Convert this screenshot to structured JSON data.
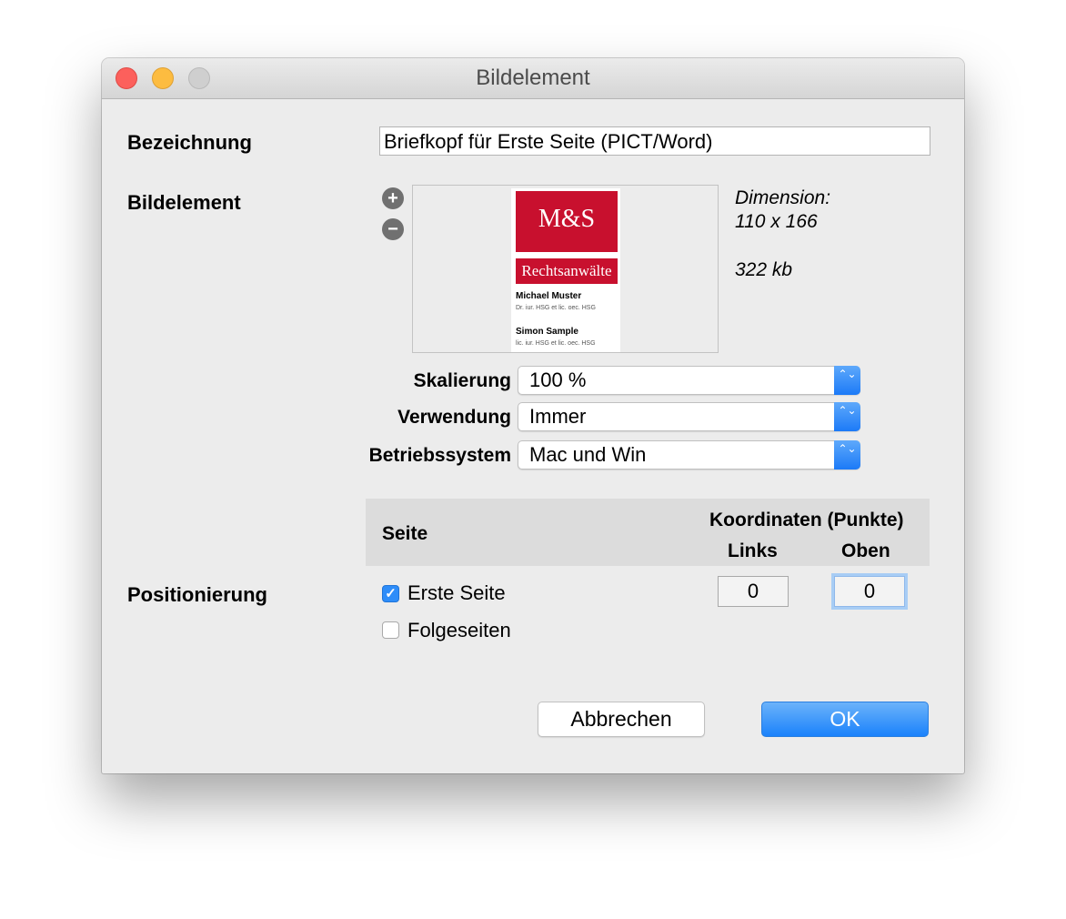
{
  "window": {
    "title": "Bildelement"
  },
  "bezeichnung": {
    "label": "Bezeichnung",
    "value": "Briefkopf für Erste Seite (PICT/Word)"
  },
  "bildelement": {
    "label": "Bildelement",
    "zoom_in": "+",
    "zoom_out": "−",
    "preview": {
      "logo_text": "M&S",
      "logo_subtitle": "Rechtsanwälte",
      "person1_name": "Michael Muster",
      "person1_title": "Dr. iur. HSG et lic. oec. HSG",
      "person2_name": "Simon Sample",
      "person2_title": "lic. iur. HSG et lic. oec. HSG"
    },
    "dimension_label": "Dimension:",
    "dimension_value": "110 x 166",
    "size": "322 kb"
  },
  "skalierung": {
    "label": "Skalierung",
    "value": "100 %"
  },
  "verwendung": {
    "label": "Verwendung",
    "value": "Immer"
  },
  "betriebssystem": {
    "label": "Betriebssystem",
    "value": "Mac und Win"
  },
  "popup_arrows": "⌃⌄",
  "positionierung": {
    "label": "Positionierung",
    "header_seite": "Seite",
    "header_koordinaten": "Koordinaten (Punkte)",
    "header_links": "Links",
    "header_oben": "Oben",
    "check_symbol": "✓",
    "rows": [
      {
        "label": "Erste Seite",
        "checked": true,
        "links": "0",
        "oben": "0"
      },
      {
        "label": "Folgeseiten",
        "checked": false
      }
    ]
  },
  "buttons": {
    "cancel": "Abbrechen",
    "ok": "OK"
  },
  "colors": {
    "accent": "#1a82fb",
    "logo_red": "#c8102e",
    "close": "#fc605c",
    "minimize": "#fdbc40"
  }
}
